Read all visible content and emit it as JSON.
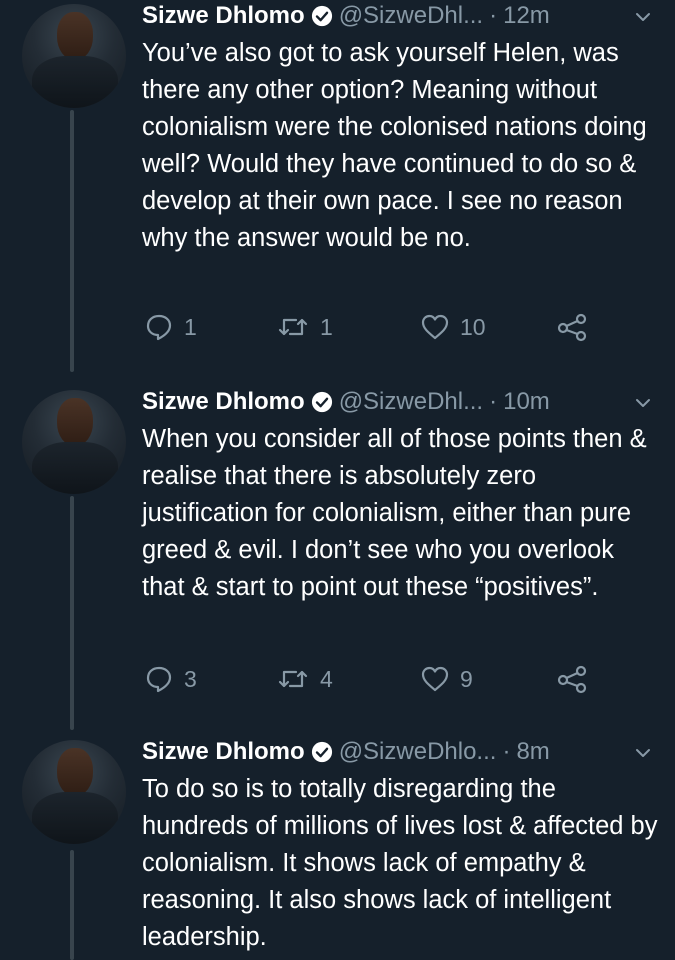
{
  "tweets": [
    {
      "name": "Sizwe Dhlomo",
      "handle": "@SizweDhl...",
      "dot": "·",
      "time": "12m",
      "text": "You’ve also got to ask yourself Helen, was there any other option? Meaning without colonialism were the colonised nations doing well? Would they have continued to do so & develop at their own pace. I see no reason why the answer would be no.",
      "replies": "1",
      "retweets": "1",
      "likes": "10"
    },
    {
      "name": "Sizwe Dhlomo",
      "handle": "@SizweDhl...",
      "dot": "·",
      "time": "10m",
      "text": "When you consider all of those points then & realise that there is absolutely zero justification for colonialism, either than pure greed & evil. I don’t see who you overlook that & start to point out these “positives”.",
      "replies": "3",
      "retweets": "4",
      "likes": "9"
    },
    {
      "name": "Sizwe Dhlomo",
      "handle": "@SizweDhlo...",
      "dot": "·",
      "time": "8m",
      "text": "To do so is to totally disregarding the hundreds of millions of lives lost & affected by colonialism. It shows lack of empathy & reasoning. It also shows lack of intelligent leadership."
    }
  ],
  "icons": {
    "verified": "verified-badge-icon",
    "caret": "chevron-down-icon",
    "reply": "reply-icon",
    "retweet": "retweet-icon",
    "like": "heart-icon",
    "share": "share-icon"
  },
  "colors": {
    "background": "#15202b",
    "text": "#ffffff",
    "secondary": "#8899a6",
    "thread_line": "#38444d"
  }
}
